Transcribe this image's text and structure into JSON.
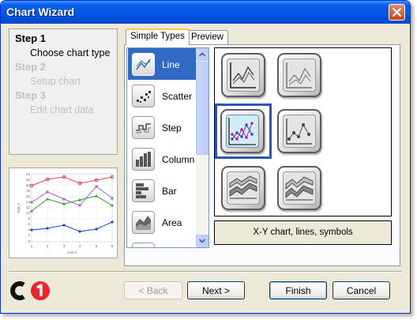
{
  "window": {
    "title": "Chart Wizard"
  },
  "steps": [
    {
      "heading": "Step 1",
      "sub": "Choose chart type",
      "active": true
    },
    {
      "heading": "Step 2",
      "sub": "Setup chart",
      "active": false
    },
    {
      "heading": "Step 3",
      "sub": "Edit chart data",
      "active": false
    }
  ],
  "preview_chart": {
    "y_ticks": [
      "24",
      "22",
      "20",
      "18",
      "16",
      "14",
      "12",
      "10",
      "8",
      "6",
      "4",
      "2",
      "0"
    ],
    "x_ticks": [
      "1",
      "2",
      "3",
      "4",
      "5",
      "6"
    ],
    "x_label": "Axis X",
    "y_label": "Axis Y"
  },
  "tabs": [
    {
      "label": "Simple Types",
      "selected": true
    },
    {
      "label": "Preview",
      "selected": false
    }
  ],
  "chart_types": [
    {
      "label": "Line",
      "icon": "line-chart-icon",
      "selected": true
    },
    {
      "label": "Scatter",
      "icon": "scatter-chart-icon",
      "selected": false
    },
    {
      "label": "Step",
      "icon": "step-chart-icon",
      "selected": false
    },
    {
      "label": "Column",
      "icon": "column-chart-icon",
      "selected": false
    },
    {
      "label": "Bar",
      "icon": "bar-chart-icon",
      "selected": false
    },
    {
      "label": "Area",
      "icon": "area-chart-icon",
      "selected": false
    }
  ],
  "gallery": {
    "selected_index": 2,
    "description": "X-Y chart, lines, symbols"
  },
  "buttons": {
    "back": "< Back",
    "next": "Next >",
    "finish": "Finish",
    "cancel": "Cancel"
  },
  "colors": {
    "title_bar": "#0556e4",
    "selection": "#316ac5",
    "gallery_selection": "#2b55b8",
    "logo_red": "#e8262b"
  }
}
